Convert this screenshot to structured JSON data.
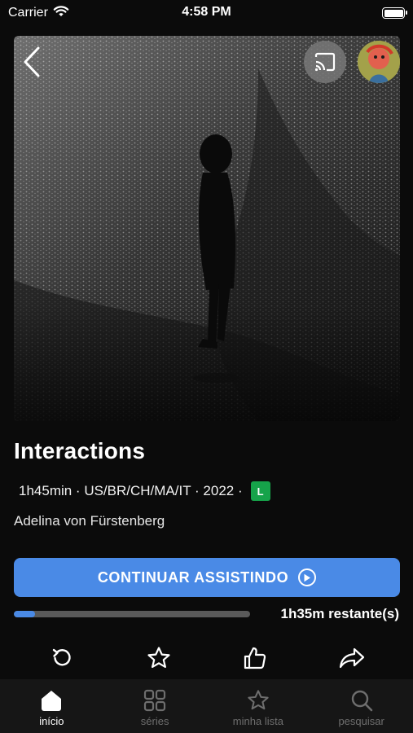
{
  "status_bar": {
    "carrier": "Carrier",
    "time": "4:58 PM"
  },
  "hero": {
    "back_icon": "chevron-left-icon",
    "cast_icon": "cast-icon",
    "avatar_icon": "profile-avatar"
  },
  "movie": {
    "title": "Interactions",
    "meta": "1h45min · US/BR/CH/MA/IT · 2022 ·",
    "rating": "L",
    "director": "Adelina von Fürstenberg"
  },
  "continue_button": {
    "label": "CONTINUAR ASSISTINDO",
    "icon": "play-circle-icon"
  },
  "progress": {
    "fraction": 0.09,
    "remaining": "1h35m restante(s)"
  },
  "actions": [
    "restart-icon",
    "star-icon",
    "thumbs-up-icon",
    "share-icon"
  ],
  "tabs": [
    {
      "label": "início",
      "icon": "home-icon",
      "active": true
    },
    {
      "label": "séries",
      "icon": "grid-icon",
      "active": false
    },
    {
      "label": "minha lista",
      "icon": "star-icon",
      "active": false
    },
    {
      "label": "pesquisar",
      "icon": "search-icon",
      "active": false
    }
  ],
  "colors": {
    "accent": "#4a8ae6",
    "rating": "#16a34a",
    "background": "#0b0b0b",
    "tabbar": "#161616"
  }
}
